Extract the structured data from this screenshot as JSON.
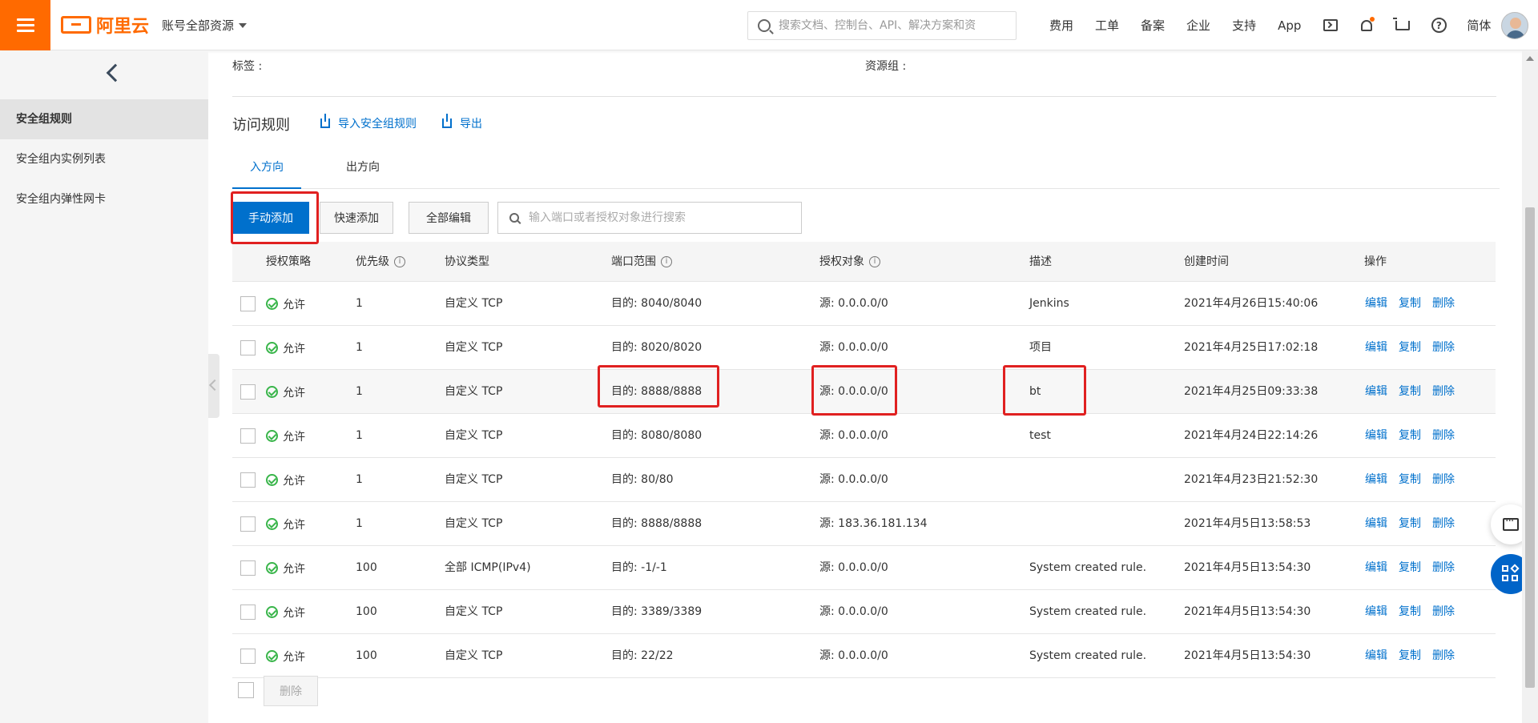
{
  "header": {
    "logo_text": "阿里云",
    "account_label": "账号全部资源",
    "search_placeholder": "搜索文档、控制台、API、解决方案和资",
    "nav": [
      "费用",
      "工单",
      "备案",
      "企业",
      "支持",
      "App"
    ],
    "lang": "简体"
  },
  "sidebar": {
    "items": [
      "安全组规则",
      "安全组内实例列表",
      "安全组内弹性网卡"
    ]
  },
  "meta": {
    "tag_label": "标签 :",
    "resource_group_label": "资源组 :"
  },
  "section": {
    "title": "访问规则",
    "import_label": "导入安全组规则",
    "export_label": "导出"
  },
  "tabs": [
    "入方向",
    "出方向"
  ],
  "toolbar": {
    "manual_add": "手动添加",
    "quick_add": "快速添加",
    "edit_all": "全部编辑",
    "search_placeholder": "输入端口或者授权对象进行搜索"
  },
  "table": {
    "headers": [
      "授权策略",
      "优先级",
      "协议类型",
      "端口范围",
      "授权对象",
      "描述",
      "创建时间",
      "操作"
    ],
    "ops": [
      "编辑",
      "复制",
      "删除"
    ],
    "rows": [
      {
        "policy": "允许",
        "priority": "1",
        "protocol": "自定义 TCP",
        "port": "目的: 8040/8040",
        "source": "源: 0.0.0.0/0",
        "desc": "Jenkins",
        "created": "2021年4月26日15:40:06"
      },
      {
        "policy": "允许",
        "priority": "1",
        "protocol": "自定义 TCP",
        "port": "目的: 8020/8020",
        "source": "源: 0.0.0.0/0",
        "desc": "项目",
        "created": "2021年4月25日17:02:18"
      },
      {
        "policy": "允许",
        "priority": "1",
        "protocol": "自定义 TCP",
        "port": "目的: 8888/8888",
        "source": "源: 0.0.0.0/0",
        "desc": "bt",
        "created": "2021年4月25日09:33:38"
      },
      {
        "policy": "允许",
        "priority": "1",
        "protocol": "自定义 TCP",
        "port": "目的: 8080/8080",
        "source": "源: 0.0.0.0/0",
        "desc": "test",
        "created": "2021年4月24日22:14:26"
      },
      {
        "policy": "允许",
        "priority": "1",
        "protocol": "自定义 TCP",
        "port": "目的: 80/80",
        "source": "源: 0.0.0.0/0",
        "desc": "",
        "created": "2021年4月23日21:52:30"
      },
      {
        "policy": "允许",
        "priority": "1",
        "protocol": "自定义 TCP",
        "port": "目的: 8888/8888",
        "source": "源: 183.36.181.134",
        "desc": "",
        "created": "2021年4月5日13:58:53"
      },
      {
        "policy": "允许",
        "priority": "100",
        "protocol": "全部 ICMP(IPv4)",
        "port": "目的: -1/-1",
        "source": "源: 0.0.0.0/0",
        "desc": "System created rule.",
        "created": "2021年4月5日13:54:30"
      },
      {
        "policy": "允许",
        "priority": "100",
        "protocol": "自定义 TCP",
        "port": "目的: 3389/3389",
        "source": "源: 0.0.0.0/0",
        "desc": "System created rule.",
        "created": "2021年4月5日13:54:30"
      },
      {
        "policy": "允许",
        "priority": "100",
        "protocol": "自定义 TCP",
        "port": "目的: 22/22",
        "source": "源: 0.0.0.0/0",
        "desc": "System created rule.",
        "created": "2021年4月5日13:54:30"
      }
    ]
  },
  "footer": {
    "delete_label": "删除"
  },
  "colors": {
    "brand_orange": "#ff6a00",
    "primary_blue": "#0070cc",
    "highlight_red": "#e02020",
    "allow_green": "#39b54a"
  }
}
